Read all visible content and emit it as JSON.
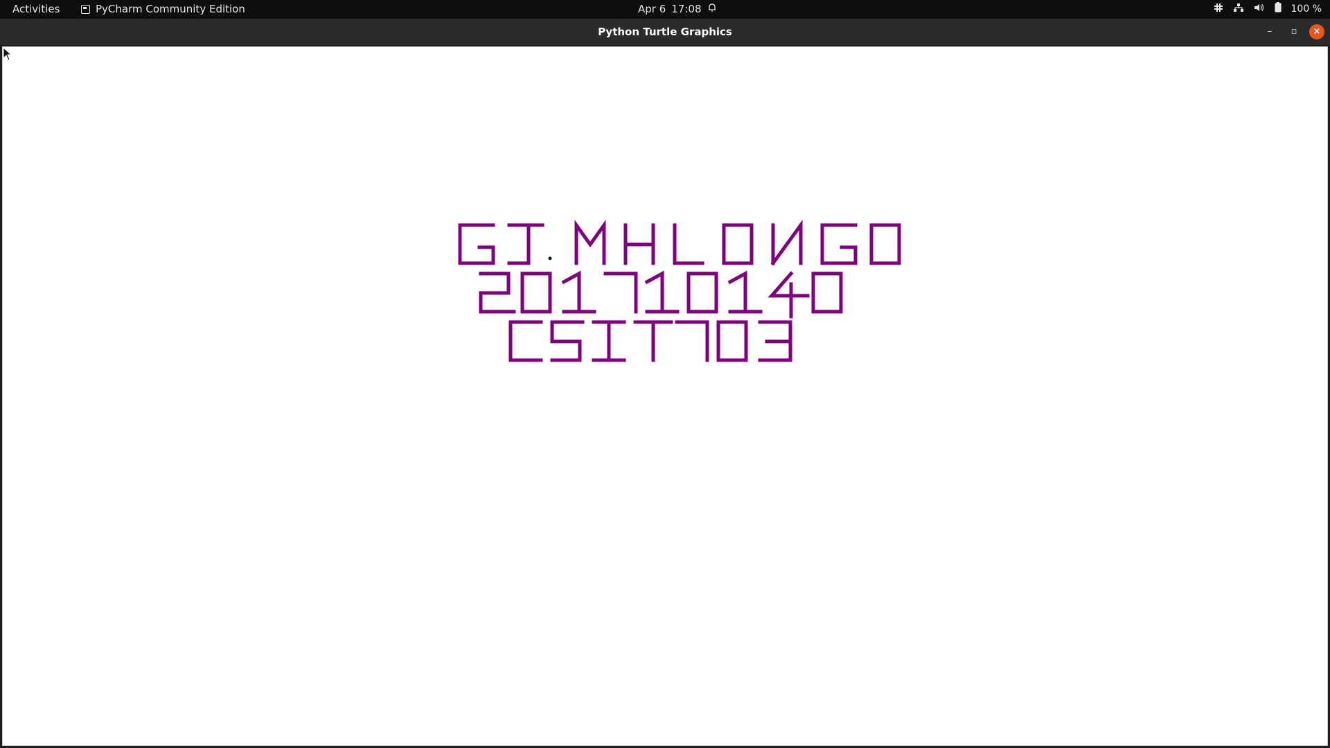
{
  "top_bar": {
    "activities": "Activities",
    "app_name": "PyCharm Community Edition",
    "date": "Apr 6",
    "time": "17:08",
    "battery": "100 %"
  },
  "window": {
    "title": "Python Turtle Graphics",
    "minimize": "–",
    "maximize": "▫",
    "close": "×"
  },
  "turtle": {
    "ink_color": "#800080",
    "lines": [
      "GJ.MHLONGO",
      "201710140",
      "CSIT703"
    ]
  }
}
